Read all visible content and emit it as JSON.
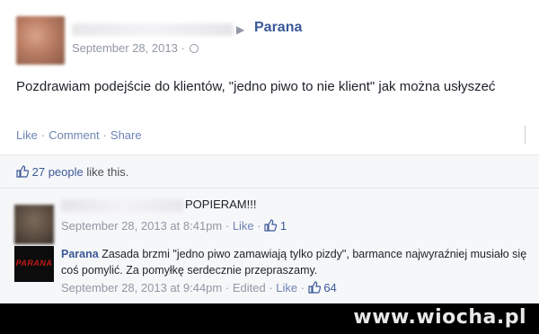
{
  "post": {
    "page_name": "Parana",
    "date": "September 28, 2013 ·",
    "text": "Pozdrawiam podejście do klientów, \"jedno piwo to nie klient\" jak można usłyszeć",
    "actions": {
      "like": "Like",
      "comment": "Comment",
      "share": "Share"
    },
    "likes_text": "27 people",
    "likes_suffix": " like this."
  },
  "comments": [
    {
      "text": "POPIERAM!!!",
      "date": "September 28, 2013 at 8:41pm",
      "like_label": "Like",
      "like_count": "1"
    },
    {
      "author": "Parana",
      "logo_text": "PARANA",
      "text": "Zasada brzmi \"jedno piwo zamawiają tylko pizdy\", barmance najwyraźniej musiało się coś pomylić. Za pomyłkę serdecznie przepraszamy.",
      "date": "September 28, 2013 at 9:44pm",
      "edited_label": "Edited",
      "like_label": "Like",
      "like_count": "64"
    }
  ],
  "watermark": "www.wiocha.pl"
}
